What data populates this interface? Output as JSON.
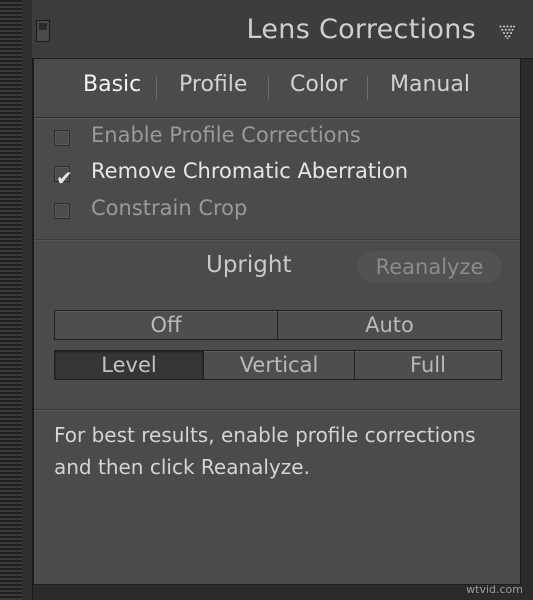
{
  "header": {
    "title": "Lens Corrections",
    "collapse_icon": "triangle-down-icon",
    "toggle_icon": "panel-switch-icon"
  },
  "tabs": [
    "Basic",
    "Profile",
    "Color",
    "Manual"
  ],
  "active_tab": "Basic",
  "checkboxes": [
    {
      "label": "Enable Profile Corrections",
      "checked": false
    },
    {
      "label": "Remove Chromatic Aberration",
      "checked": true
    },
    {
      "label": "Constrain Crop",
      "checked": false
    }
  ],
  "check_mark": "✔",
  "upright": {
    "label": "Upright",
    "reanalyze_label": "Reanalyze",
    "row1": [
      "Off",
      "Auto"
    ],
    "row2": [
      "Level",
      "Vertical",
      "Full"
    ],
    "selected": "Level"
  },
  "info_text": "For best results, enable profile corrections and then click Reanalyze.",
  "watermark": "wtvid.com",
  "colors": {
    "panel_bg": "#4b4b4b",
    "header_bg": "#3d3d3d",
    "text": "#d4d4d4",
    "selected_segment": "#363636"
  }
}
